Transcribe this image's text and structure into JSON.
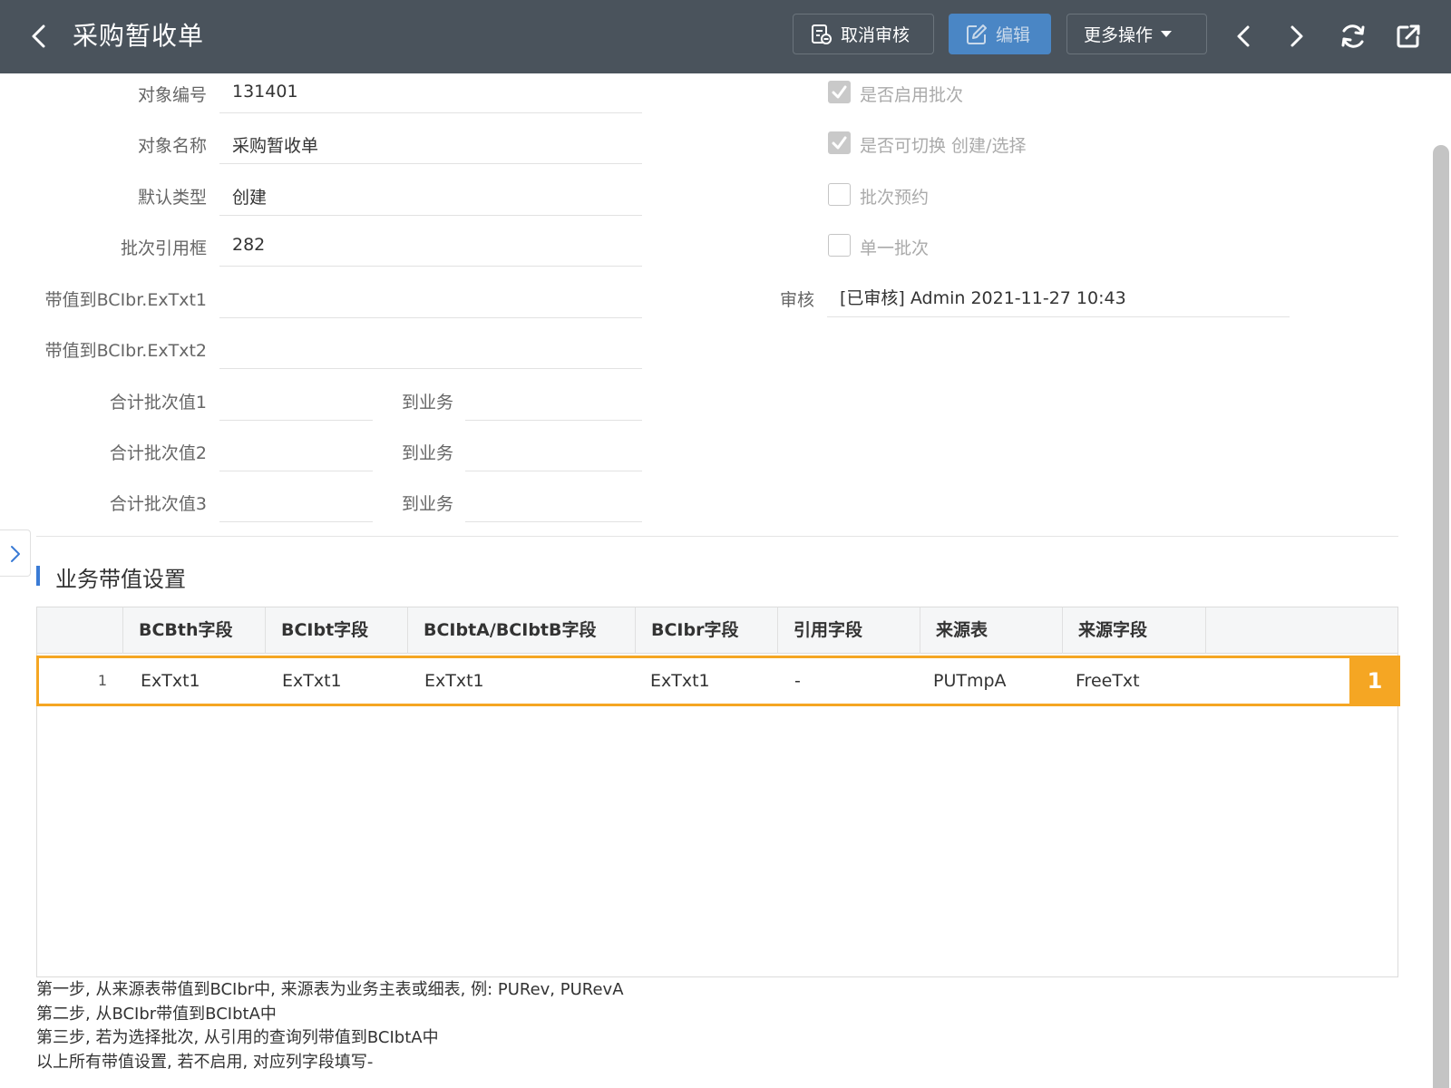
{
  "header": {
    "title": "采购暂收单",
    "cancel_audit_label": "取消审核",
    "edit_label": "编辑",
    "more_label": "更多操作"
  },
  "fields": {
    "object_code": {
      "label": "对象编号",
      "value": "131401"
    },
    "object_name": {
      "label": "对象名称",
      "value": "采购暂收单"
    },
    "default_type": {
      "label": "默认类型",
      "value": "创建"
    },
    "batch_ref_box": {
      "label": "批次引用框",
      "value": "282"
    },
    "bring_value_1": {
      "label": "带值到BCIbr.ExTxt1",
      "value": ""
    },
    "bring_value_2": {
      "label": "带值到BCIbr.ExTxt2",
      "value": ""
    },
    "total_rows": [
      {
        "label": "合计批次值1",
        "to_label": "到业务",
        "value": "",
        "to_value": ""
      },
      {
        "label": "合计批次值2",
        "to_label": "到业务",
        "value": "",
        "to_value": ""
      },
      {
        "label": "合计批次值3",
        "to_label": "到业务",
        "value": "",
        "to_value": ""
      }
    ],
    "checkboxes": [
      {
        "label": "是否启用批次",
        "checked": true
      },
      {
        "label": "是否可切换 创建/选择",
        "checked": true
      },
      {
        "label": "批次预约",
        "checked": false
      },
      {
        "label": "单一批次",
        "checked": false
      }
    ],
    "audit": {
      "label": "审核",
      "value": "[已审核] Admin 2021-11-27 10:43"
    }
  },
  "section": {
    "title": "业务带值设置"
  },
  "table": {
    "columns": [
      "BCBth字段",
      "BCIbt字段",
      "BCIbtA/BCIbtB字段",
      "BCIbr字段",
      "引用字段",
      "来源表",
      "来源字段"
    ],
    "rows": [
      {
        "index": "1",
        "cells": [
          "ExTxt1",
          "ExTxt1",
          "ExTxt1",
          "ExTxt1",
          "-",
          "PUTmpA",
          "FreeTxt"
        ],
        "badge": "1"
      }
    ]
  },
  "notes": [
    "第一步, 从来源表带值到BCIbr中, 来源表为业务主表或细表, 例: PURev, PURevA",
    "第二步, 从BCIbr带值到BCIbtA中",
    "第三步, 若为选择批次, 从引用的查询列带值到BCIbtA中",
    "以上所有带值设置, 若不启用, 对应列字段填写-"
  ],
  "colors": {
    "header_bg": "#4a535c",
    "accent": "#3a7bd5",
    "highlight": "#f5a623",
    "edit_btn": "#4a86c5"
  }
}
